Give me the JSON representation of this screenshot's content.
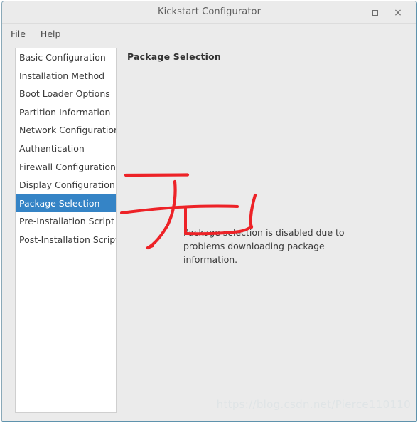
{
  "window": {
    "title": "Kickstart Configurator",
    "controls": {
      "minimize": "minimize-button",
      "maximize": "maximize-button",
      "close": "×"
    }
  },
  "menubar": {
    "items": [
      {
        "label": "File"
      },
      {
        "label": "Help"
      }
    ]
  },
  "sidebar": {
    "items": [
      {
        "label": "Basic Configuration",
        "selected": false
      },
      {
        "label": "Installation Method",
        "selected": false
      },
      {
        "label": "Boot Loader Options",
        "selected": false
      },
      {
        "label": "Partition Information",
        "selected": false
      },
      {
        "label": "Network Configuration",
        "selected": false
      },
      {
        "label": "Authentication",
        "selected": false
      },
      {
        "label": "Firewall Configuration",
        "selected": false
      },
      {
        "label": "Display Configuration",
        "selected": false
      },
      {
        "label": "Package Selection",
        "selected": true
      },
      {
        "label": "Pre-Installation Script",
        "selected": false
      },
      {
        "label": "Post-Installation Script",
        "selected": false
      }
    ]
  },
  "main": {
    "heading": "Package Selection",
    "message_line1": "Package selection is disabled due to",
    "message_line2": "problems downloading package information."
  },
  "annotation": {
    "color": "#ed2227",
    "description": "hand-drawn red mark"
  },
  "watermark": {
    "text": "https://blog.csdn.net/Pierce110110"
  },
  "colors": {
    "window_background": "#ebebeb",
    "list_background": "#ffffff",
    "selection_blue": "#3584c6",
    "border_teal": "#6f9bb0",
    "annotation_red": "#ed2227",
    "watermark_gray": "#dfe4e6"
  }
}
